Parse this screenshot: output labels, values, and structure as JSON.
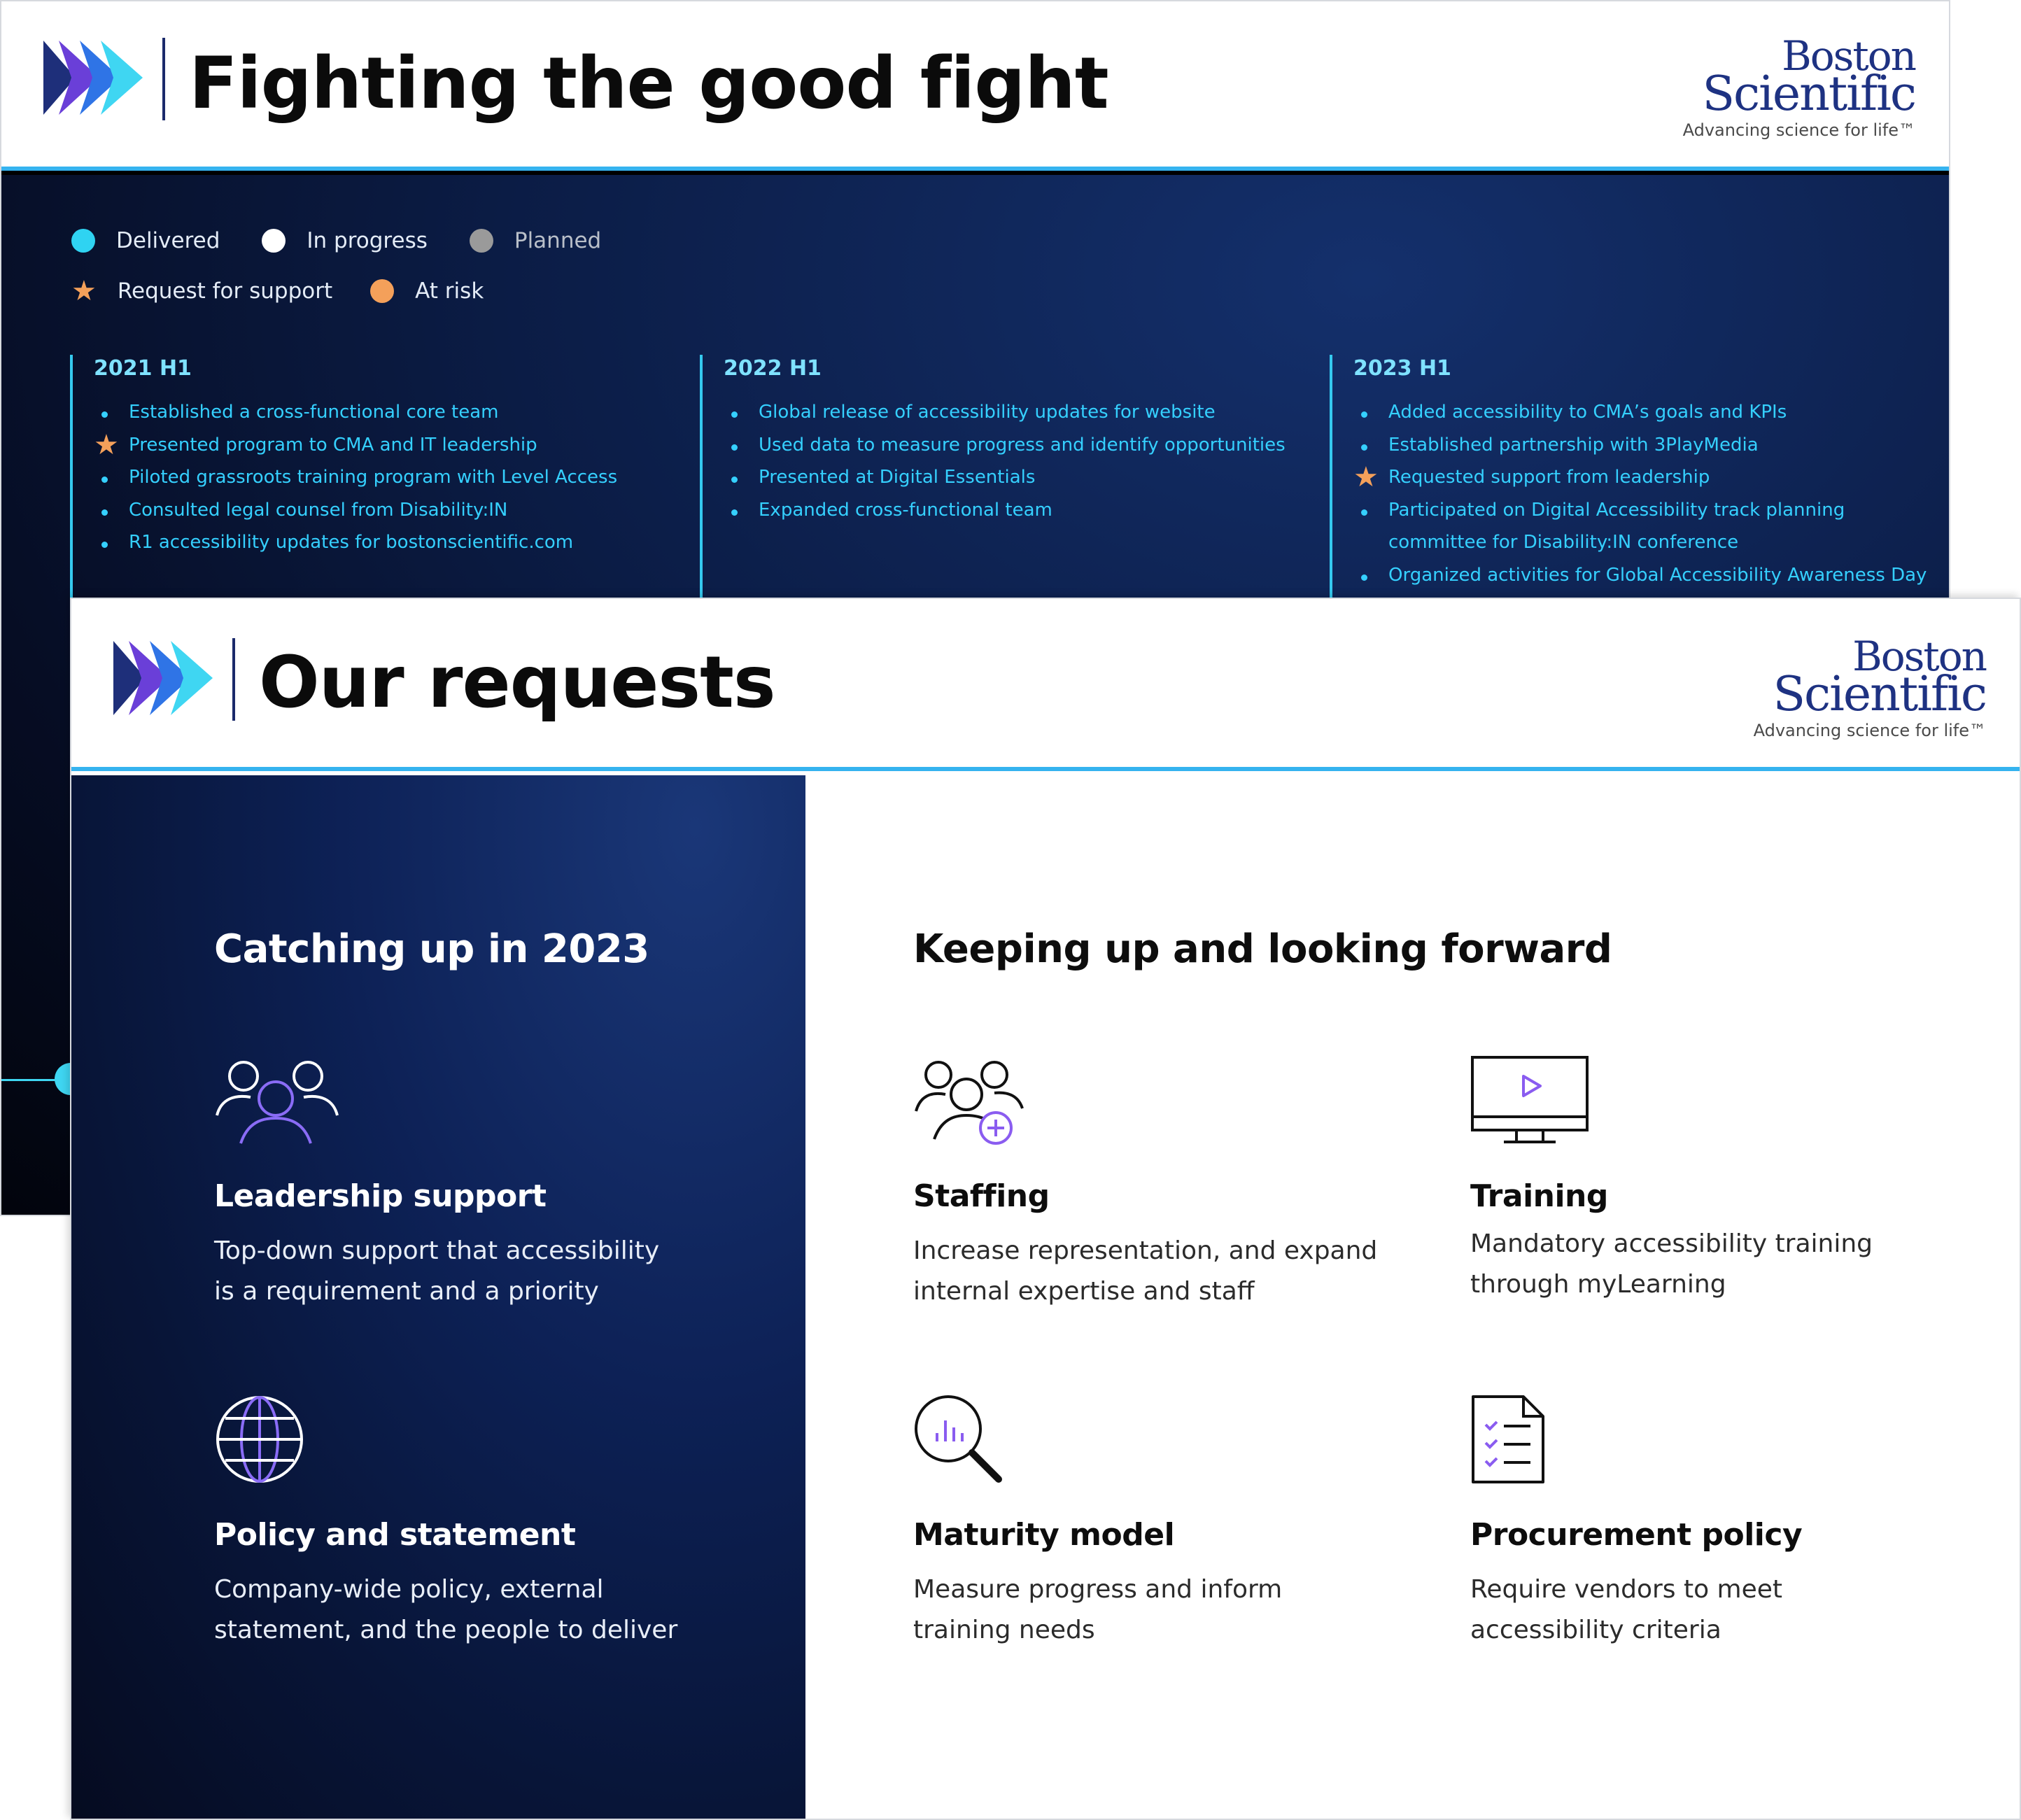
{
  "slide1": {
    "title": "Fighting the good fight",
    "brand": {
      "line1": "Boston",
      "line2": "Scientific",
      "tagline": "Advancing science for life™"
    },
    "legend": [
      {
        "label": "Delivered",
        "color": "#2fd3f2",
        "marker": "dot"
      },
      {
        "label": "In progress",
        "color": "#ffffff",
        "marker": "dot"
      },
      {
        "label": "Planned",
        "color": "#9a9a9a",
        "marker": "dot"
      },
      {
        "label": "Request for support",
        "color": "#f4a05a",
        "marker": "star-icon"
      },
      {
        "label": "At risk",
        "color": "#f4a05a",
        "marker": "dot"
      }
    ],
    "columns": [
      {
        "title": "2021 H1",
        "items": [
          {
            "text": "Established a cross-functional core team",
            "marker": "bullet"
          },
          {
            "text": "Presented program to CMA and IT leadership",
            "marker": "star"
          },
          {
            "text": "Piloted grassroots training program with Level Access",
            "marker": "bullet"
          },
          {
            "text": "Consulted legal counsel from Disability:IN",
            "marker": "bullet"
          },
          {
            "text": "R1 accessibility updates for bostonscientific.com",
            "marker": "bullet"
          }
        ]
      },
      {
        "title": "2022 H1",
        "items": [
          {
            "text": "Global release of accessibility updates for website",
            "marker": "bullet"
          },
          {
            "text": "Used data to measure progress and identify opportunities",
            "marker": "bullet"
          },
          {
            "text": "Presented at Digital Essentials",
            "marker": "bullet"
          },
          {
            "text": "Expanded cross-functional team",
            "marker": "bullet"
          }
        ]
      },
      {
        "title": "2023 H1",
        "items": [
          {
            "text": "Added accessibility to CMA’s goals and KPIs",
            "marker": "bullet"
          },
          {
            "text": "Established partnership with 3PlayMedia",
            "marker": "bullet"
          },
          {
            "text": "Requested support from leadership",
            "marker": "star"
          },
          {
            "text": "Participated on Digital Accessibility track planning",
            "marker": "bullet"
          },
          {
            "text": "committee for Disability:IN conference",
            "marker": "none"
          },
          {
            "text": "Organized activities for Global Accessibility Awareness Day",
            "marker": "bullet"
          }
        ]
      }
    ]
  },
  "slide2": {
    "title": "Our requests",
    "brand": {
      "line1": "Boston",
      "line2": "Scientific",
      "tagline": "Advancing science for life™"
    },
    "left": {
      "heading": "Catching up in 2023",
      "cards": [
        {
          "icon": "people-group-icon",
          "title": "Leadership support",
          "desc": "Top-down support that accessibility is a requirement and a priority"
        },
        {
          "icon": "globe-icon",
          "title": "Policy and statement",
          "desc": "Company-wide policy, external statement, and the people to deliver"
        }
      ]
    },
    "right": {
      "heading": "Keeping up and looking forward",
      "cards": [
        {
          "icon": "add-people-icon",
          "title": "Staffing",
          "desc": "Increase representation, and expand internal expertise and staff"
        },
        {
          "icon": "monitor-play-icon",
          "title": "Training",
          "desc": "Mandatory accessibility training through myLearning"
        },
        {
          "icon": "magnifier-chart-icon",
          "title": "Maturity model",
          "desc": "Measure progress and inform training needs"
        },
        {
          "icon": "checklist-document-icon",
          "title": "Procurement policy",
          "desc": "Require vendors to meet accessibility criteria"
        }
      ]
    }
  }
}
